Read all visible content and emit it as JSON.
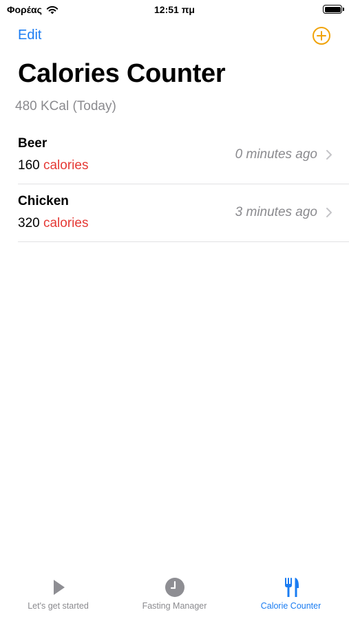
{
  "status_bar": {
    "carrier": "Φορέας",
    "time": "12:51 πμ"
  },
  "nav": {
    "edit_label": "Edit",
    "add_icon": "plus-circle-icon"
  },
  "header": {
    "title": "Calories Counter",
    "subtitle": "480 KCal (Today)"
  },
  "entries": [
    {
      "name": "Beer",
      "calories": "160",
      "unit": "calories",
      "time": "0 minutes ago"
    },
    {
      "name": "Chicken",
      "calories": "320",
      "unit": "calories",
      "time": "3 minutes ago"
    }
  ],
  "tab_bar": {
    "tabs": [
      {
        "label": "Let's get started",
        "icon": "play-icon",
        "active": false
      },
      {
        "label": "Fasting Manager",
        "icon": "clock-icon",
        "active": false
      },
      {
        "label": "Calorie Counter",
        "icon": "fork-knife-icon",
        "active": true
      }
    ]
  },
  "colors": {
    "accent_blue": "#1a7cf2",
    "add_orange": "#f0a30a",
    "calories_red": "#e53935",
    "secondary_gray": "#8a8a8e",
    "inactive_tab_icon": "#8e8e93"
  }
}
